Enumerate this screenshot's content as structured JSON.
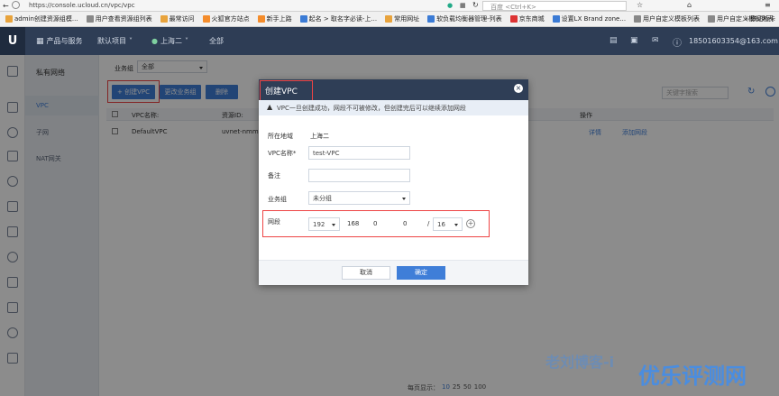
{
  "browser": {
    "url": "https://console.ucloud.cn/vpc/vpc",
    "search_placeholder": "百度 <Ctrl+K>",
    "bookmarks": [
      "admin创建资源组模...",
      "用户查看资源组列表",
      "最常访问",
      "火狐官方站点",
      "新手上路",
      "起名 > 取名字必读-上...",
      "常用网址",
      "软负载均衡器管理-列表",
      "京东商城",
      "设置LX Brand zone...",
      "用户自定义模板列表",
      "用户自定义模板列表"
    ],
    "bookmarks_more": "移动析卡"
  },
  "appbar": {
    "logo": "U",
    "products": "产品与服务",
    "project": "默认项目",
    "region": "上海二",
    "zone": "全部",
    "account": "18501603354@163.com"
  },
  "subnav": {
    "title": "私有网络",
    "items": [
      "VPC",
      "子网",
      "NAT网关"
    ]
  },
  "content": {
    "group_label": "业务组",
    "group_value": "全部",
    "create_button": "+ 创建VPC",
    "change_group_button": "更改业务组",
    "delete_button": "删除",
    "search_placeholder": "关键字搜索",
    "columns": [
      "VPC名称:",
      "资源ID:",
      "操作"
    ],
    "row": {
      "name": "DefaultVPC",
      "id": "uvnet-nmmwj",
      "details": "详情",
      "add_segment": "添加网段"
    },
    "pagination": {
      "label": "每页显示：",
      "options": [
        "10",
        "25",
        "50",
        "100"
      ]
    }
  },
  "modal": {
    "title": "创建VPC",
    "notice": "VPC一旦创建成功，网段不可被修改，但创建完后可以继续添加网段",
    "region_label": "所在地域",
    "region_value": "上海二",
    "name_label": "VPC名称*",
    "name_value": "test-VPC",
    "remark_label": "备注",
    "remark_value": "",
    "group_label": "业务组",
    "group_value": "未分组",
    "segment_label": "网段",
    "segment": {
      "o1": "192",
      "o2": "168",
      "o3": "0",
      "o4": "0",
      "sep": "/",
      "mask": "16"
    },
    "cancel": "取消",
    "confirm": "确定"
  },
  "watermark": {
    "faint": "老刘博客-i",
    "bold": "优乐评测网"
  },
  "colors": {
    "accent": "#3f7ed8",
    "header": "#2e3d55",
    "highlight": "#e44444"
  }
}
